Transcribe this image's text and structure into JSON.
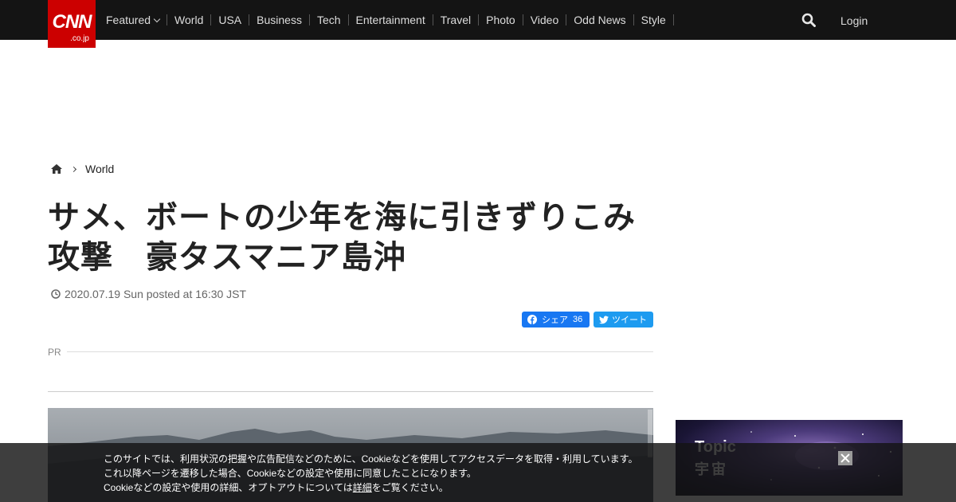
{
  "header": {
    "logo_main": "CNN",
    "logo_sub": ".co.jp",
    "nav": [
      {
        "label": "Featured",
        "dropdown": true
      },
      {
        "label": "World"
      },
      {
        "label": "USA"
      },
      {
        "label": "Business"
      },
      {
        "label": "Tech"
      },
      {
        "label": "Entertainment"
      },
      {
        "label": "Travel"
      },
      {
        "label": "Photo"
      },
      {
        "label": "Video"
      },
      {
        "label": "Odd News"
      },
      {
        "label": "Style"
      }
    ],
    "search_icon": "search-icon",
    "login_label": "Login"
  },
  "breadcrumb": {
    "home_icon": "home-icon",
    "section": "World"
  },
  "article": {
    "headline_line1": "サメ、ボートの少年を海に引きずりこみ",
    "headline_line2": "攻撃　豪タスマニア島沖",
    "dateline": "2020.07.19 Sun posted at 16:30 JST"
  },
  "share": {
    "facebook_label": "シェア",
    "facebook_count": "36",
    "twitter_label": "ツイート"
  },
  "pr_label": "PR",
  "sidebar_ad": {
    "title": "Topic",
    "subtitle": "宇宙"
  },
  "cookie_banner": {
    "line1": "このサイトでは、利用状況の把握や広告配信などのために、Cookieなどを使用してアクセスデータを取得・利用しています。",
    "line2": "これ以降ページを遷移した場合、Cookieなどの設定や使用に同意したことになります。",
    "line3_before": "Cookieなどの設定や使用の詳細、オプトアウトについては",
    "line3_link": "詳細",
    "line3_after": "をご覧ください。"
  },
  "colors": {
    "brand_red": "#cc0000",
    "nav_background": "#141414",
    "facebook_blue": "#1877f2",
    "twitter_blue": "#1d9bf0"
  }
}
